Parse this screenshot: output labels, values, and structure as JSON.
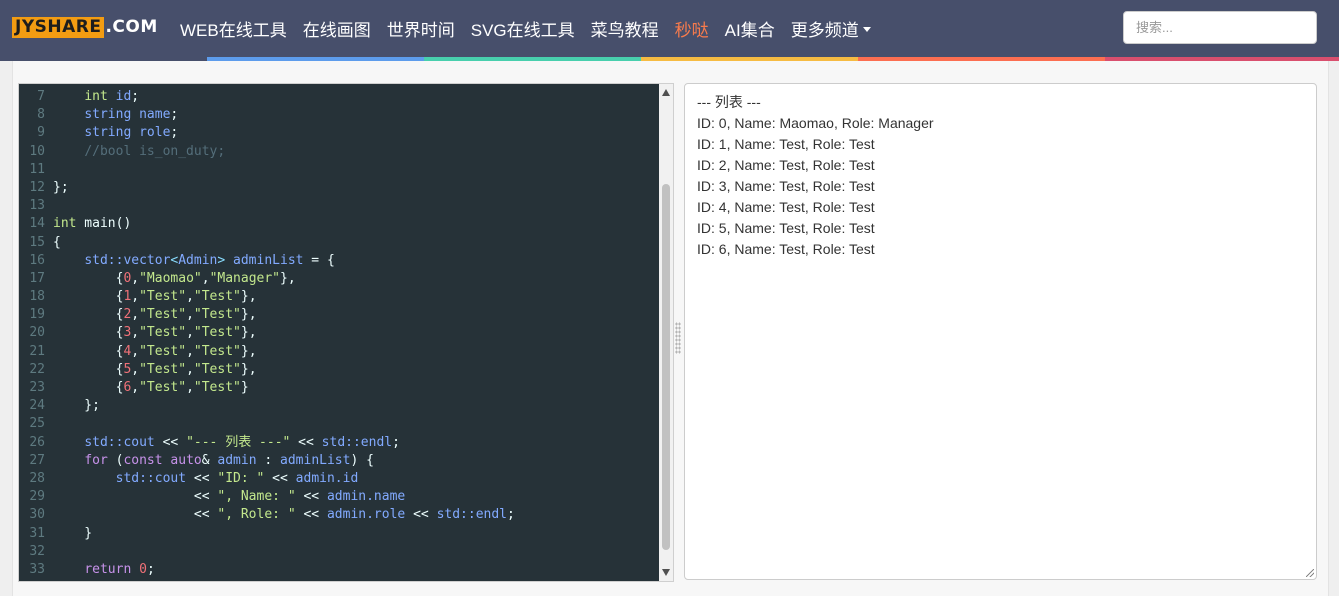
{
  "logo": {
    "main": "JYSHARE",
    "suffix": ".COM"
  },
  "nav": [
    {
      "label": "WEB在线工具",
      "highlight": false
    },
    {
      "label": "在线画图",
      "highlight": false
    },
    {
      "label": "世界时间",
      "highlight": false
    },
    {
      "label": "SVG在线工具",
      "highlight": false
    },
    {
      "label": "菜鸟教程",
      "highlight": false
    },
    {
      "label": "秒哒",
      "highlight": true
    },
    {
      "label": "AI集合",
      "highlight": false
    },
    {
      "label": "更多频道",
      "highlight": false,
      "dropdown": true
    }
  ],
  "search": {
    "placeholder": "搜索..."
  },
  "color_strip": [
    "#474f6b",
    "#5d9cec",
    "#48cfad",
    "#f6bb42",
    "#fc6e51",
    "#d94f6e"
  ],
  "editor": {
    "lines": [
      {
        "n": "7",
        "tokens": [
          [
            "    ",
            ""
          ],
          [
            "int",
            "t-kw"
          ],
          [
            " ",
            ""
          ],
          [
            "id",
            "t-var"
          ],
          [
            ";",
            "t-plain"
          ]
        ]
      },
      {
        "n": "8",
        "tokens": [
          [
            "    ",
            ""
          ],
          [
            "string",
            "t-var"
          ],
          [
            " ",
            ""
          ],
          [
            "name",
            "t-var"
          ],
          [
            ";",
            "t-plain"
          ]
        ]
      },
      {
        "n": "9",
        "tokens": [
          [
            "    ",
            ""
          ],
          [
            "string",
            "t-var"
          ],
          [
            " ",
            ""
          ],
          [
            "role",
            "t-var"
          ],
          [
            ";",
            "t-plain"
          ]
        ]
      },
      {
        "n": "10",
        "tokens": [
          [
            "    ",
            ""
          ],
          [
            "//bool is_on_duty;",
            "t-cmt"
          ]
        ]
      },
      {
        "n": "11",
        "tokens": []
      },
      {
        "n": "12",
        "tokens": [
          [
            "};",
            "t-plain"
          ]
        ]
      },
      {
        "n": "13",
        "tokens": []
      },
      {
        "n": "14",
        "tokens": [
          [
            "int",
            "t-kw"
          ],
          [
            " main()",
            "t-plain"
          ]
        ]
      },
      {
        "n": "15",
        "tokens": [
          [
            "{",
            "t-plain"
          ]
        ]
      },
      {
        "n": "16",
        "tokens": [
          [
            "    ",
            ""
          ],
          [
            "std::vector",
            "t-var"
          ],
          [
            "<",
            "t-op"
          ],
          [
            "Admin",
            "t-var"
          ],
          [
            "> ",
            "t-op"
          ],
          [
            "adminList",
            "t-var"
          ],
          [
            " = {",
            "t-plain"
          ]
        ]
      },
      {
        "n": "17",
        "tokens": [
          [
            "        {",
            ""
          ],
          [
            "0",
            "t-num"
          ],
          [
            ",",
            "t-plain"
          ],
          [
            "\"Maomao\"",
            "t-str"
          ],
          [
            ",",
            "t-plain"
          ],
          [
            "\"Manager\"",
            "t-str"
          ],
          [
            "},",
            "t-plain"
          ]
        ]
      },
      {
        "n": "18",
        "tokens": [
          [
            "        {",
            ""
          ],
          [
            "1",
            "t-num"
          ],
          [
            ",",
            "t-plain"
          ],
          [
            "\"Test\"",
            "t-str"
          ],
          [
            ",",
            "t-plain"
          ],
          [
            "\"Test\"",
            "t-str"
          ],
          [
            "},",
            "t-plain"
          ]
        ]
      },
      {
        "n": "19",
        "tokens": [
          [
            "        {",
            ""
          ],
          [
            "2",
            "t-num"
          ],
          [
            ",",
            "t-plain"
          ],
          [
            "\"Test\"",
            "t-str"
          ],
          [
            ",",
            "t-plain"
          ],
          [
            "\"Test\"",
            "t-str"
          ],
          [
            "},",
            "t-plain"
          ]
        ]
      },
      {
        "n": "20",
        "tokens": [
          [
            "        {",
            ""
          ],
          [
            "3",
            "t-num"
          ],
          [
            ",",
            "t-plain"
          ],
          [
            "\"Test\"",
            "t-str"
          ],
          [
            ",",
            "t-plain"
          ],
          [
            "\"Test\"",
            "t-str"
          ],
          [
            "},",
            "t-plain"
          ]
        ]
      },
      {
        "n": "21",
        "tokens": [
          [
            "        {",
            ""
          ],
          [
            "4",
            "t-num"
          ],
          [
            ",",
            "t-plain"
          ],
          [
            "\"Test\"",
            "t-str"
          ],
          [
            ",",
            "t-plain"
          ],
          [
            "\"Test\"",
            "t-str"
          ],
          [
            "},",
            "t-plain"
          ]
        ]
      },
      {
        "n": "22",
        "tokens": [
          [
            "        {",
            ""
          ],
          [
            "5",
            "t-num"
          ],
          [
            ",",
            "t-plain"
          ],
          [
            "\"Test\"",
            "t-str"
          ],
          [
            ",",
            "t-plain"
          ],
          [
            "\"Test\"",
            "t-str"
          ],
          [
            "},",
            "t-plain"
          ]
        ]
      },
      {
        "n": "23",
        "tokens": [
          [
            "        {",
            ""
          ],
          [
            "6",
            "t-num"
          ],
          [
            ",",
            "t-plain"
          ],
          [
            "\"Test\"",
            "t-str"
          ],
          [
            ",",
            "t-plain"
          ],
          [
            "\"Test\"",
            "t-str"
          ],
          [
            "}",
            "t-plain"
          ]
        ]
      },
      {
        "n": "24",
        "tokens": [
          [
            "    };",
            "t-plain"
          ]
        ]
      },
      {
        "n": "25",
        "tokens": []
      },
      {
        "n": "26",
        "tokens": [
          [
            "    ",
            ""
          ],
          [
            "std::cout",
            "t-var"
          ],
          [
            " << ",
            "t-plain"
          ],
          [
            "\"--- 列表 ---\"",
            "t-str"
          ],
          [
            " << ",
            "t-plain"
          ],
          [
            "std::endl",
            "t-var"
          ],
          [
            ";",
            "t-plain"
          ]
        ]
      },
      {
        "n": "27",
        "tokens": [
          [
            "    ",
            ""
          ],
          [
            "for",
            "t-kw2"
          ],
          [
            " (",
            "t-plain"
          ],
          [
            "const",
            "t-kw2"
          ],
          [
            " ",
            ""
          ],
          [
            "auto",
            "t-kw2"
          ],
          [
            "& ",
            "t-plain"
          ],
          [
            "admin",
            "t-var"
          ],
          [
            " : ",
            "t-plain"
          ],
          [
            "adminList",
            "t-var"
          ],
          [
            ") {",
            "t-plain"
          ]
        ]
      },
      {
        "n": "28",
        "tokens": [
          [
            "        ",
            ""
          ],
          [
            "std::cout",
            "t-var"
          ],
          [
            " << ",
            "t-plain"
          ],
          [
            "\"ID: \"",
            "t-str"
          ],
          [
            " << ",
            "t-plain"
          ],
          [
            "admin.id",
            "t-var"
          ]
        ]
      },
      {
        "n": "29",
        "tokens": [
          [
            "                  << ",
            "t-plain"
          ],
          [
            "\", Name: \"",
            "t-str"
          ],
          [
            " << ",
            "t-plain"
          ],
          [
            "admin.name",
            "t-var"
          ]
        ]
      },
      {
        "n": "30",
        "tokens": [
          [
            "                  << ",
            "t-plain"
          ],
          [
            "\", Role: \"",
            "t-str"
          ],
          [
            " << ",
            "t-plain"
          ],
          [
            "admin.role",
            "t-var"
          ],
          [
            " << ",
            "t-plain"
          ],
          [
            "std::endl",
            "t-var"
          ],
          [
            ";",
            "t-plain"
          ]
        ]
      },
      {
        "n": "31",
        "tokens": [
          [
            "    }",
            "t-plain"
          ]
        ]
      },
      {
        "n": "32",
        "tokens": []
      },
      {
        "n": "33",
        "tokens": [
          [
            "    ",
            ""
          ],
          [
            "return",
            "t-kw2"
          ],
          [
            " ",
            ""
          ],
          [
            "0",
            "t-num"
          ],
          [
            ";",
            "t-plain"
          ]
        ]
      }
    ]
  },
  "output": {
    "lines": [
      "--- 列表 ---",
      "ID: 0, Name: Maomao, Role: Manager",
      "ID: 1, Name: Test, Role: Test",
      "ID: 2, Name: Test, Role: Test",
      "ID: 3, Name: Test, Role: Test",
      "ID: 4, Name: Test, Role: Test",
      "ID: 5, Name: Test, Role: Test",
      "ID: 6, Name: Test, Role: Test"
    ]
  }
}
